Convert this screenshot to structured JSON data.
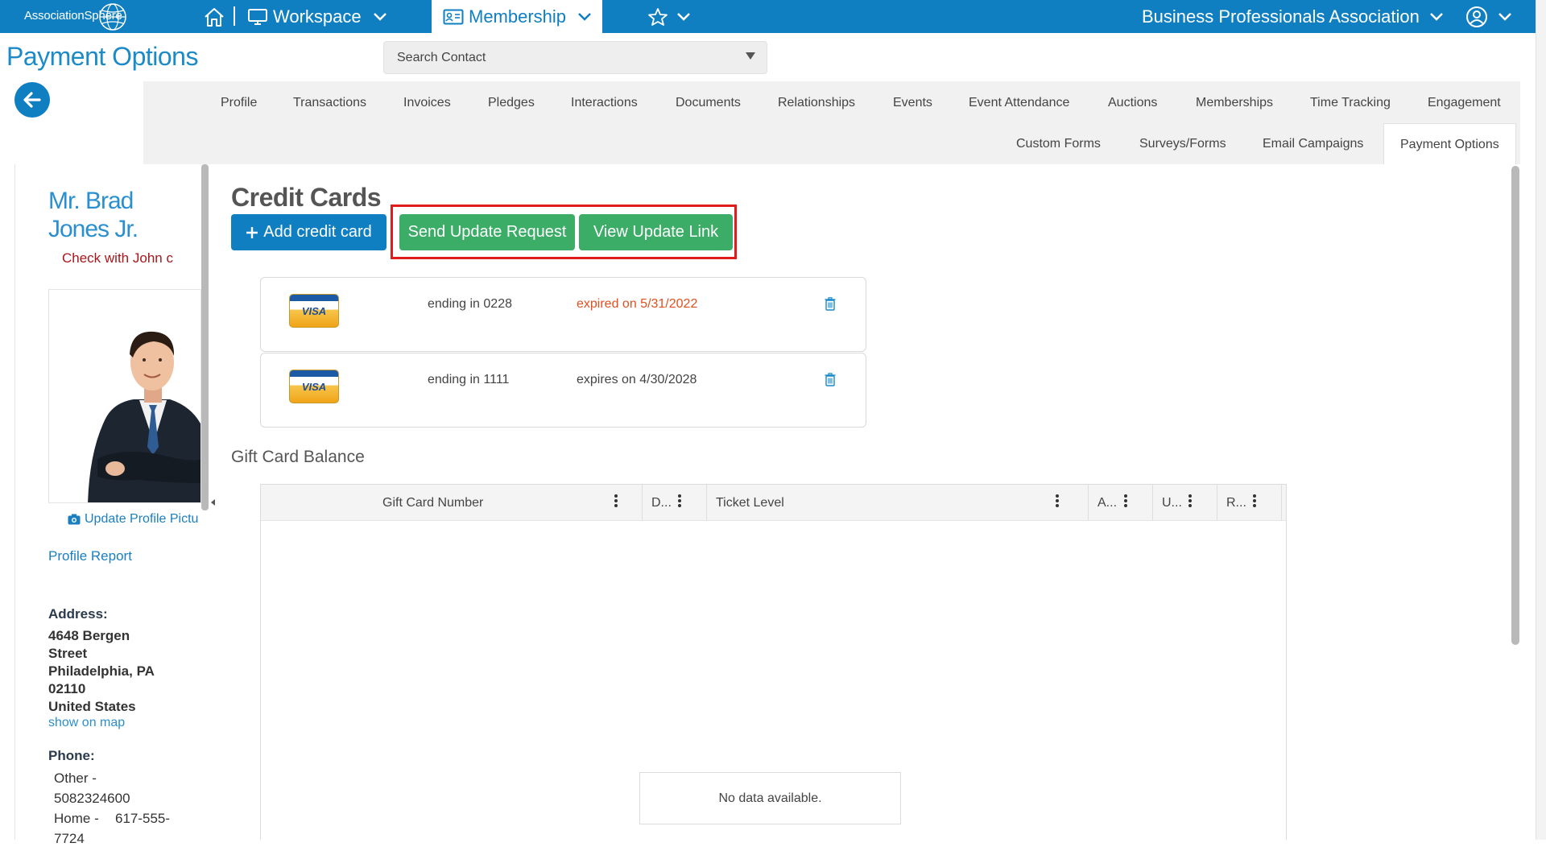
{
  "topbar": {
    "logo": "AssociationSphere",
    "workspace_label": "Workspace",
    "membership_label": "Membership",
    "org_name": "Business Professionals Association"
  },
  "page": {
    "title": "Payment Options",
    "search_placeholder": "Search Contact"
  },
  "tabs": {
    "row1": [
      "Profile",
      "Transactions",
      "Invoices",
      "Pledges",
      "Interactions",
      "Documents",
      "Relationships",
      "Events",
      "Event Attendance",
      "Auctions",
      "Memberships",
      "Time Tracking",
      "Engagement"
    ],
    "row2": [
      "Custom Forms",
      "Surveys/Forms",
      "Email Campaigns",
      "Payment Options"
    ],
    "active": "Payment Options"
  },
  "profile": {
    "name_line1": "Mr. Brad",
    "name_line2": "Jones Jr.",
    "note": "Check with John c",
    "update_picture": "Update Profile Pictu",
    "profile_report": "Profile Report",
    "address_label": "Address:",
    "address_lines": [
      "4648 Bergen",
      "Street",
      "Philadelphia, PA",
      "02110",
      "United States"
    ],
    "show_on_map": "show on map",
    "phone_label": "Phone:",
    "phone_other_label": "Other -",
    "phone_other_value": "5082324600",
    "phone_home_label": "Home -",
    "phone_home_value": "617-555-",
    "phone_home_value2": "7724"
  },
  "credit_cards": {
    "heading": "Credit Cards",
    "add_button": "Add credit card",
    "send_update_button": "Send Update Request",
    "view_link_button": "View Update Link",
    "cards": [
      {
        "brand": "VISA",
        "ending": "ending in 0228",
        "expiry": "expired on 5/31/2022",
        "expired": true
      },
      {
        "brand": "VISA",
        "ending": "ending in 1111",
        "expiry": "expires on 4/30/2028",
        "expired": false
      }
    ],
    "expired_color": "#e1501f"
  },
  "gift_cards": {
    "heading": "Gift Card Balance",
    "columns": [
      "Gift Card Number",
      "D...",
      "Ticket Level",
      "A...",
      "U...",
      "R..."
    ],
    "empty_text": "No data available."
  },
  "colors": {
    "primary": "#0f7fc2",
    "success": "#3cad67",
    "highlight": "#e21b1b"
  }
}
